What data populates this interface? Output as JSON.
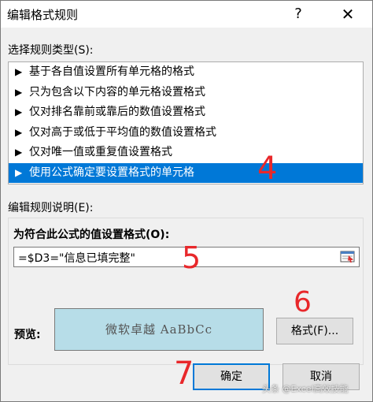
{
  "window": {
    "title": "编辑格式规则",
    "help_glyph": "?",
    "close_glyph": "✕"
  },
  "rule_type_section": {
    "label": "选择规则类型(S):"
  },
  "rule_types": [
    {
      "label": "基于各自值设置所有单元格的格式",
      "selected": false
    },
    {
      "label": "只为包含以下内容的单元格设置格式",
      "selected": false
    },
    {
      "label": "仅对排名靠前或靠后的数值设置格式",
      "selected": false
    },
    {
      "label": "仅对高于或低于平均值的数值设置格式",
      "selected": false
    },
    {
      "label": "仅对唯一值或重复值设置格式",
      "selected": false
    },
    {
      "label": "使用公式确定要设置格式的单元格",
      "selected": true
    }
  ],
  "list_arrow_glyph": "▶",
  "description_section": {
    "label": "编辑规则说明(E):"
  },
  "formula": {
    "label": "为符合此公式的值设置格式(O):",
    "value": "=$D3=\"信息已填完整\""
  },
  "preview": {
    "label": "预览:",
    "sample_text": "微软卓越   AaBbCc",
    "fill_color": "#b7dde8"
  },
  "buttons": {
    "format": "格式(F)...",
    "ok": "确定",
    "cancel": "取消"
  },
  "annotations": {
    "step4": "4",
    "step5": "5",
    "step6": "6",
    "step7": "7",
    "color": "#e8282b"
  },
  "watermark": "头条 @Excel高效技能",
  "colors": {
    "selection": "#0078d7",
    "dialog_bg": "#f0f0f0"
  }
}
